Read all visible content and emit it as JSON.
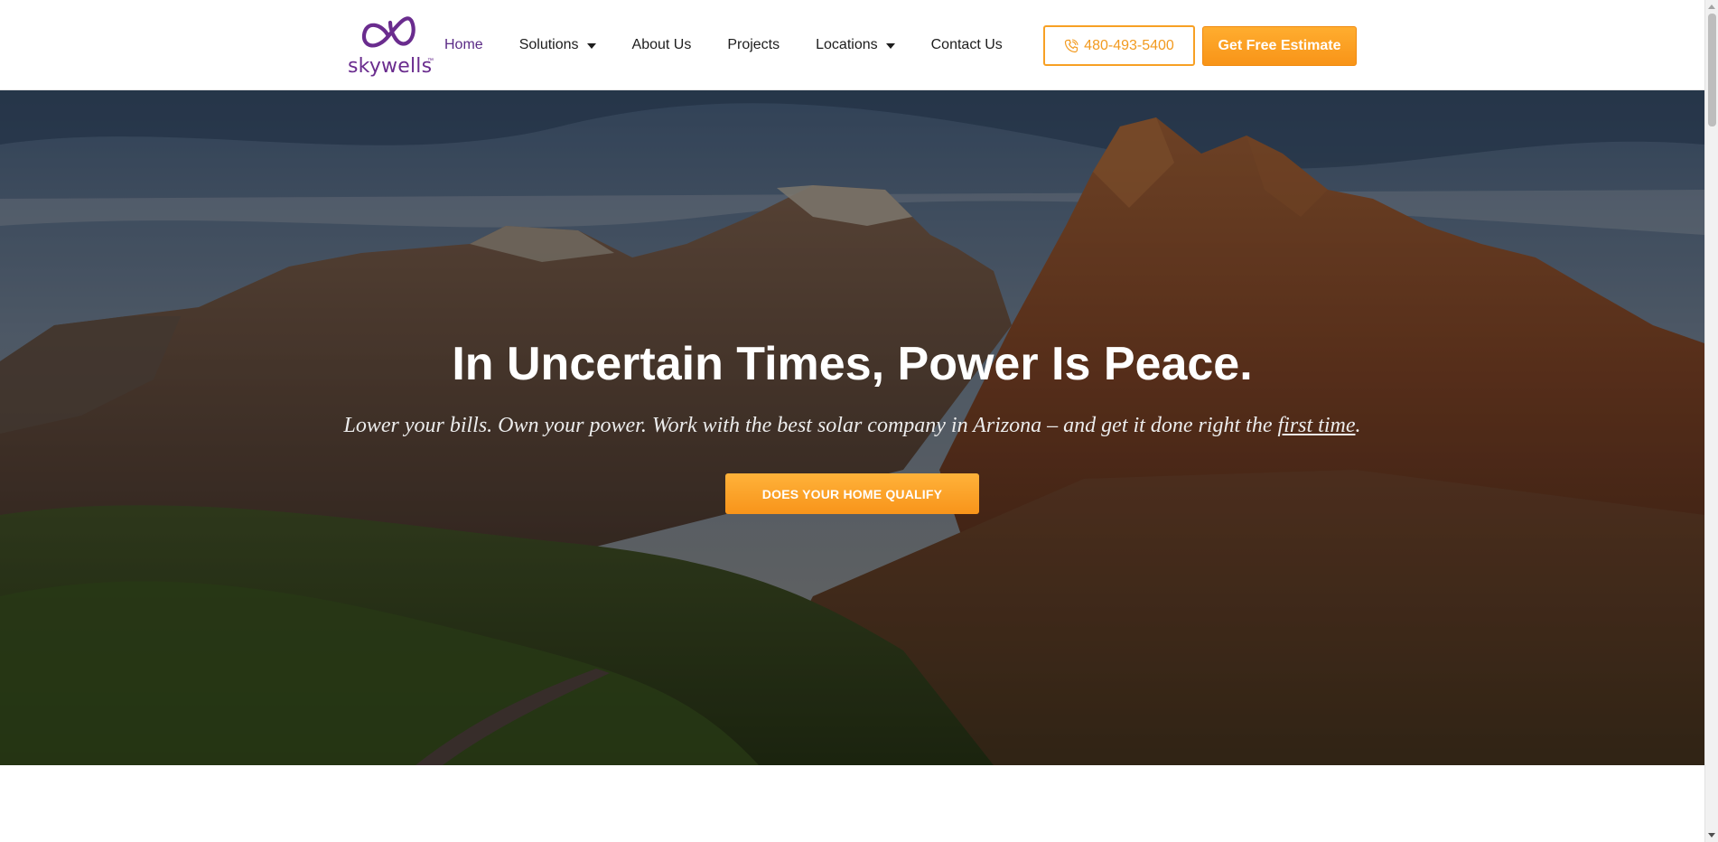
{
  "header": {
    "logo_text": "skywells",
    "logo_tm": "™",
    "nav": [
      {
        "label": "Home",
        "active": true,
        "dropdown": false
      },
      {
        "label": "Solutions",
        "active": false,
        "dropdown": true
      },
      {
        "label": "About Us",
        "active": false,
        "dropdown": false
      },
      {
        "label": "Projects",
        "active": false,
        "dropdown": false
      },
      {
        "label": "Locations",
        "active": false,
        "dropdown": true
      },
      {
        "label": "Contact Us",
        "active": false,
        "dropdown": false
      }
    ],
    "phone_label": "480-493-5400",
    "estimate_label": "Get Free Estimate"
  },
  "hero": {
    "title": "In Uncertain Times, Power Is Peace.",
    "subtitle_before": "Lower your bills. Own your power. Work with the best solar company in Arizona – and get it done right the ",
    "subtitle_link": "first time",
    "subtitle_after": ".",
    "cta_label": "DOES YOUR HOME QUALIFY"
  },
  "colors": {
    "brand_purple": "#5b2b86",
    "accent_orange": "#f7a024",
    "nav_text": "#1d1d1d"
  },
  "icons": {
    "phone": "phone-icon",
    "logo": "infinity-logo-icon",
    "caret": "caret-down-icon"
  }
}
